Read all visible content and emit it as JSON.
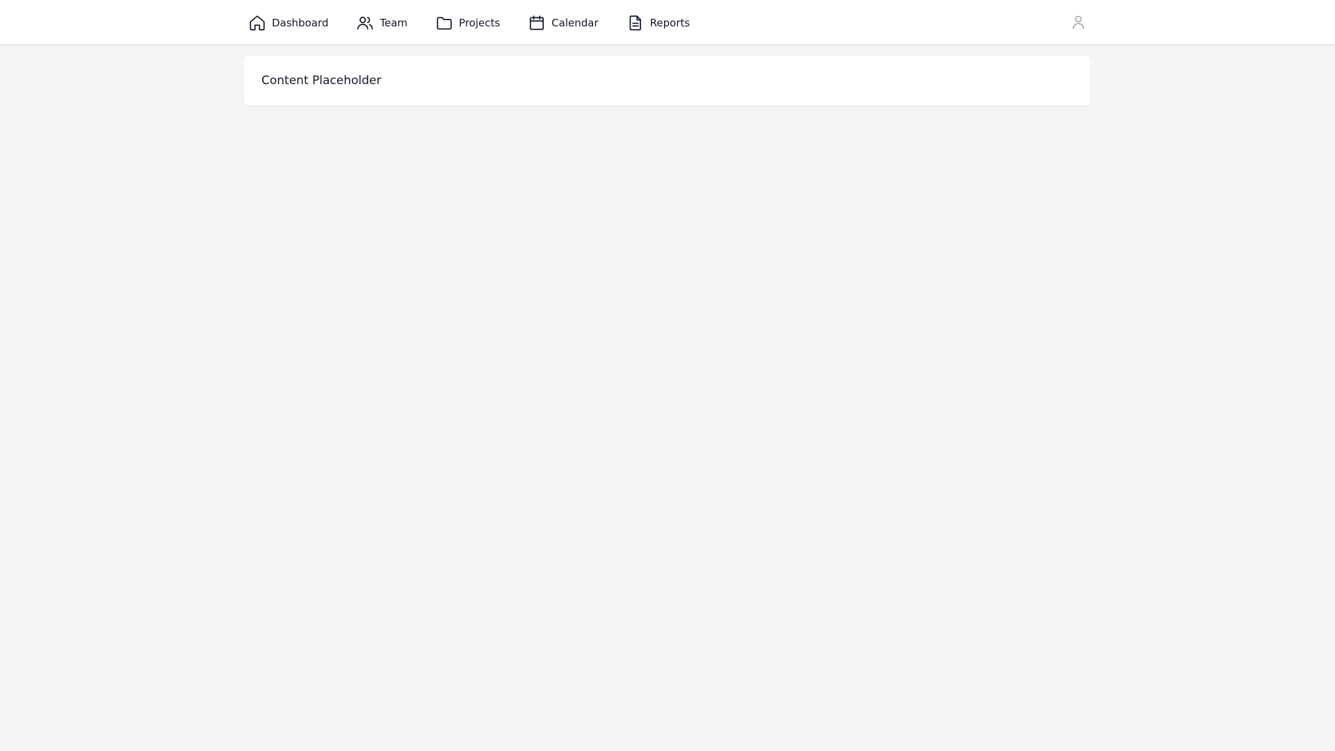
{
  "nav": {
    "items": [
      {
        "label": "Dashboard",
        "icon": "home-icon"
      },
      {
        "label": "Team",
        "icon": "users-icon"
      },
      {
        "label": "Projects",
        "icon": "folder-icon"
      },
      {
        "label": "Calendar",
        "icon": "calendar-icon"
      },
      {
        "label": "Reports",
        "icon": "document-icon"
      }
    ]
  },
  "user": {
    "icon": "user-icon"
  },
  "main": {
    "placeholder_text": "Content Placeholder"
  },
  "colors": {
    "background": "#f3f4f6",
    "topbar": "#ffffff",
    "card": "#ffffff",
    "text": "#111827",
    "muted_icon": "#9ca3af"
  }
}
